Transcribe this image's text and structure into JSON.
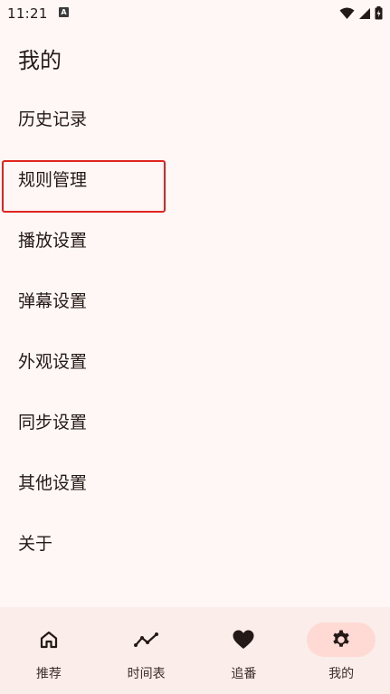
{
  "status_bar": {
    "time": "11:21",
    "notification_icon": "a-icon",
    "wifi_icon": "wifi-icon",
    "signal_icon": "signal-icon",
    "battery_icon": "battery-icon"
  },
  "page": {
    "title": "我的"
  },
  "menu": {
    "items": [
      {
        "label": "历史记录"
      },
      {
        "label": "规则管理"
      },
      {
        "label": "播放设置"
      },
      {
        "label": "弹幕设置"
      },
      {
        "label": "外观设置"
      },
      {
        "label": "同步设置"
      },
      {
        "label": "其他设置"
      },
      {
        "label": "关于"
      }
    ],
    "highlighted_item": "规则管理",
    "highlight_color": "#E0241F"
  },
  "bottom_nav": {
    "items": [
      {
        "label": "推荐",
        "icon": "home-icon"
      },
      {
        "label": "时间表",
        "icon": "trend-icon"
      },
      {
        "label": "追番",
        "icon": "heart-icon"
      },
      {
        "label": "我的",
        "icon": "gear-icon"
      }
    ],
    "active": "我的",
    "active_pill_color": "#FFDAD4"
  },
  "colors": {
    "background": "#FFF7F5",
    "nav_background": "#FBEDEA",
    "text": "#231917"
  }
}
